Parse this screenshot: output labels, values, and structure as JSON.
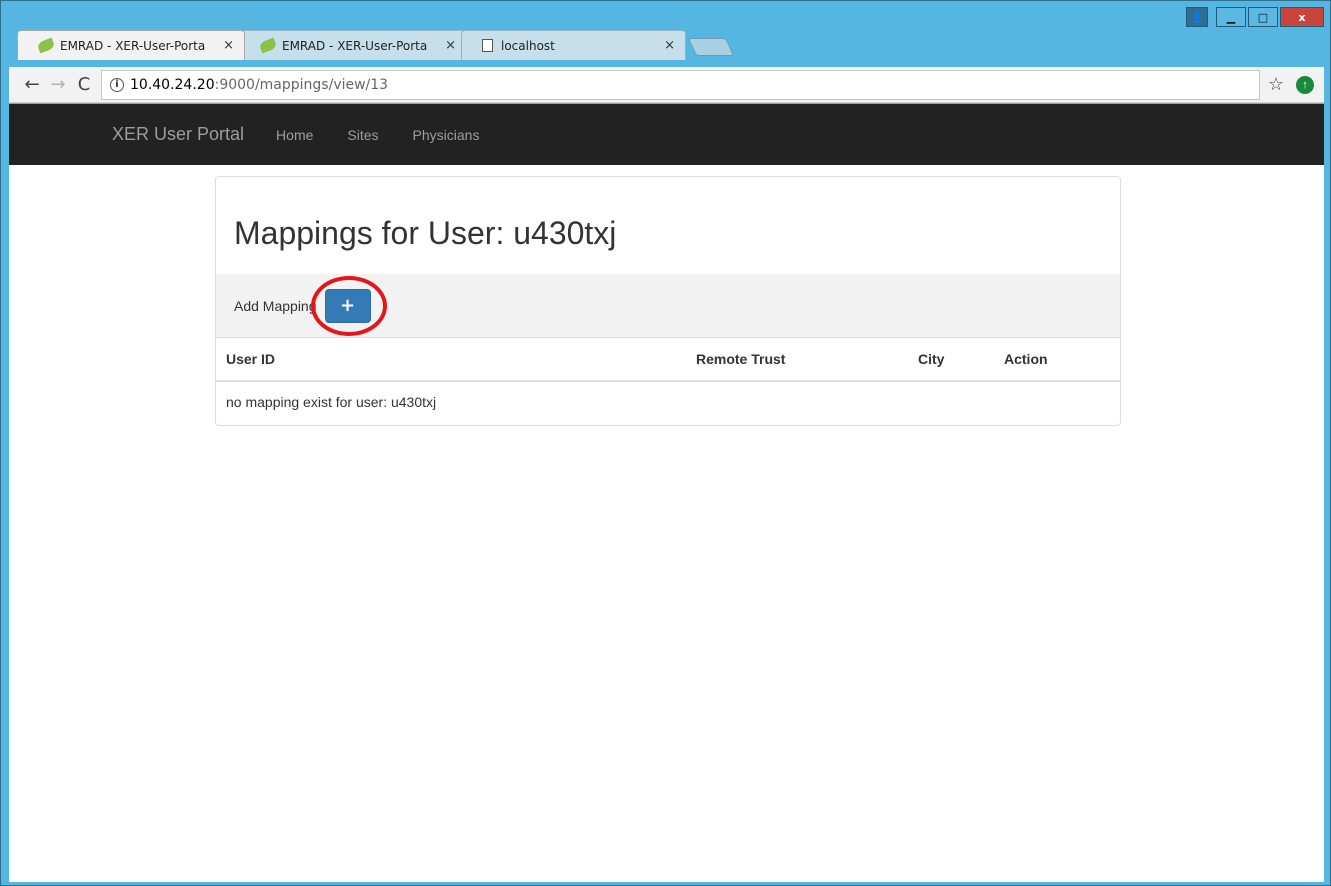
{
  "browser": {
    "tabs": [
      {
        "title": "EMRAD - XER-User-Porta",
        "active": true,
        "icon": "leaf-icon"
      },
      {
        "title": "EMRAD - XER-User-Porta",
        "active": false,
        "icon": "leaf-icon"
      },
      {
        "title": "localhost",
        "active": false,
        "icon": "page-icon"
      }
    ],
    "tab_close": "×",
    "address": {
      "host": "10.40.24.20",
      "path": ":9000/mappings/view/13"
    },
    "nav": {
      "back": "←",
      "forward": "→",
      "reload": "C",
      "info": "i",
      "star": "☆"
    },
    "window_controls": {
      "user": "👤",
      "minimize": "▁",
      "maximize": "□",
      "close": "x"
    }
  },
  "navbar": {
    "brand": "XER User Portal",
    "links": [
      "Home",
      "Sites",
      "Physicians"
    ]
  },
  "main": {
    "heading": "Mappings for User: u430txj",
    "add_label": "Add Mapping",
    "add_button": "+",
    "table": {
      "headers": [
        "User ID",
        "Remote Trust",
        "City",
        "Action"
      ],
      "empty_message": "no mapping exist for user: u430txj"
    }
  },
  "colors": {
    "accent": "#337ab7",
    "highlight": "#e5151c",
    "navbar_bg": "#222222"
  }
}
